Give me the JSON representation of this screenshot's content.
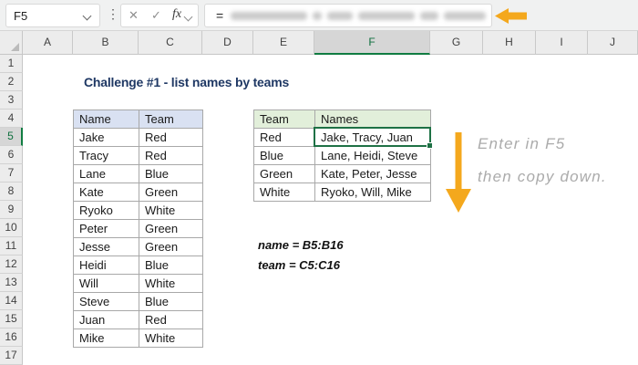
{
  "formula_bar": {
    "name_box": "F5",
    "cancel_icon": "✕",
    "enter_icon": "✓",
    "fx_label": "fx",
    "formula_prefix": "=",
    "formula_redacted": true
  },
  "sheet": {
    "title": "Challenge #1 - list names by teams",
    "column_headers": [
      "A",
      "B",
      "C",
      "D",
      "E",
      "F",
      "G",
      "H",
      "I",
      "J"
    ],
    "row_headers": [
      "1",
      "2",
      "3",
      "4",
      "5",
      "6",
      "7",
      "8",
      "9",
      "10",
      "11",
      "12",
      "13",
      "14",
      "15",
      "16",
      "17"
    ],
    "selected_cell": "F5",
    "selected_column": "F",
    "selected_row": "5"
  },
  "source_table": {
    "range": "B4:C16",
    "headers": [
      "Name",
      "Team"
    ],
    "rows": [
      [
        "Jake",
        "Red"
      ],
      [
        "Tracy",
        "Red"
      ],
      [
        "Lane",
        "Blue"
      ],
      [
        "Kate",
        "Green"
      ],
      [
        "Ryoko",
        "White"
      ],
      [
        "Peter",
        "Green"
      ],
      [
        "Jesse",
        "Green"
      ],
      [
        "Heidi",
        "Blue"
      ],
      [
        "Will",
        "White"
      ],
      [
        "Steve",
        "Blue"
      ],
      [
        "Juan",
        "Red"
      ],
      [
        "Mike",
        "White"
      ]
    ]
  },
  "result_table": {
    "range": "E4:F8",
    "headers": [
      "Team",
      "Names"
    ],
    "rows": [
      [
        "Red",
        "Jake, Tracy, Juan"
      ],
      [
        "Blue",
        "Lane, Heidi, Steve"
      ],
      [
        "Green",
        "Kate, Peter, Jesse"
      ],
      [
        "White",
        "Ryoko, Will, Mike"
      ]
    ]
  },
  "annotations": {
    "note_line1": "Enter in F5",
    "note_line2": "then copy down.",
    "range1": "name = B5:B16",
    "range2": "team = C5:C16"
  },
  "colors": {
    "accent_green": "#107C41",
    "selection_green": "#1E7145",
    "arrow_orange": "#F4A81D",
    "source_header_bg": "#D9E1F2",
    "result_header_bg": "#E2EFDA",
    "title_color": "#1F3864"
  }
}
